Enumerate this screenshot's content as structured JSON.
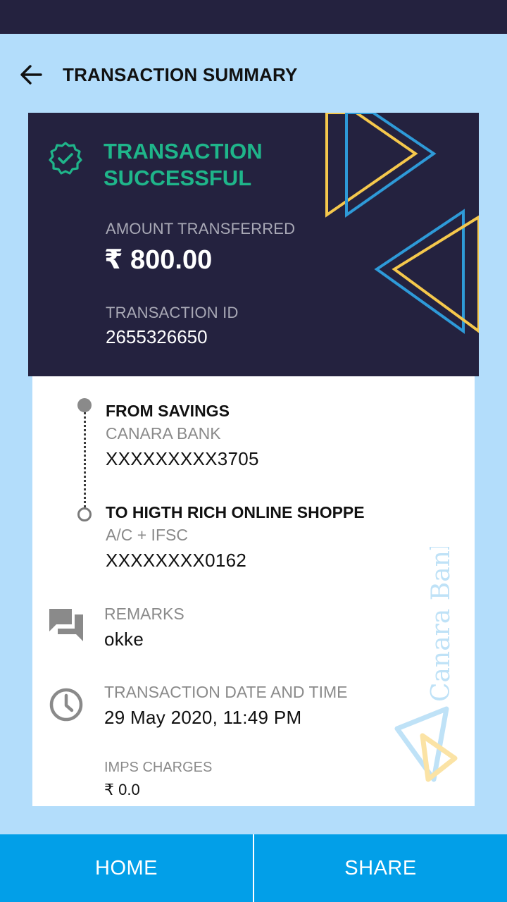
{
  "header": {
    "title": "TRANSACTION SUMMARY",
    "back_icon": "arrow-left-icon"
  },
  "summary": {
    "status_text": "TRANSACTION SUCCESSFUL",
    "status_icon": "check-badge-icon",
    "amount_label": "AMOUNT TRANSFERRED",
    "amount_value": "₹ 800.00",
    "txn_id_label": "TRANSACTION ID",
    "txn_id_value": "2655326650"
  },
  "from": {
    "title": "FROM SAVINGS",
    "bank": "CANARA BANK",
    "account": "XXXXXXXXX3705"
  },
  "to": {
    "title": "TO HIGTH RICH ONLINE SHOPPE",
    "type": "A/C + IFSC",
    "account": "XXXXXXXX0162"
  },
  "remarks": {
    "label": "REMARKS",
    "value": "okke",
    "icon": "chat-bubbles-icon"
  },
  "datetime": {
    "label": "TRANSACTION DATE AND TIME",
    "value": "29 May 2020, 11:49 PM",
    "icon": "clock-icon"
  },
  "charges": {
    "label": "IMPS CHARGES",
    "value": "₹ 0.0"
  },
  "watermark": {
    "text": "Canara Bank"
  },
  "footer": {
    "home_label": "HOME",
    "share_label": "SHARE"
  },
  "colors": {
    "background": "#b3ddfb",
    "card": "#24223f",
    "success": "#1fb58a",
    "footer": "#029fe8",
    "deco_yellow": "#f5c84c",
    "deco_blue": "#2e9ad8"
  }
}
